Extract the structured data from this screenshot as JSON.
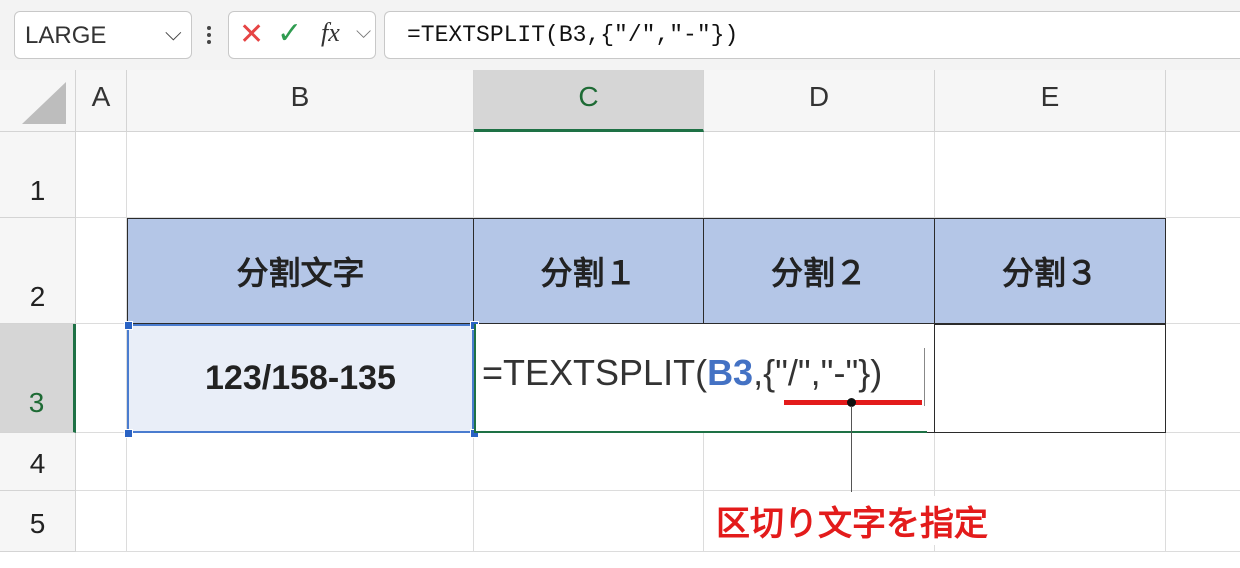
{
  "formula_bar": {
    "name_box": "LARGE",
    "cancel_glyph": "✕",
    "enter_glyph": "✓",
    "fx_label": "fx",
    "formula": "=TEXTSPLIT(B3,{\"/\",\"-\"})"
  },
  "columns": [
    "A",
    "B",
    "C",
    "D",
    "E"
  ],
  "rows": [
    "1",
    "2",
    "3",
    "4",
    "5"
  ],
  "selected_cell": "C3",
  "table": {
    "headers": [
      "分割文字",
      "分割１",
      "分割２",
      "分割３"
    ],
    "b3_value": "123/158-135"
  },
  "edit": {
    "prefix": "=TEXTSPLIT(",
    "ref": "B3",
    "suffix": ",{\"/\",\"-\"})"
  },
  "annotation": "区切り文字を指定",
  "colors": {
    "header_fill": "#b4c6e7",
    "selected_fill": "#e9eef8",
    "ref_blue": "#4472c4",
    "annotation_red": "#e31b1b",
    "excel_green": "#1e7145"
  }
}
